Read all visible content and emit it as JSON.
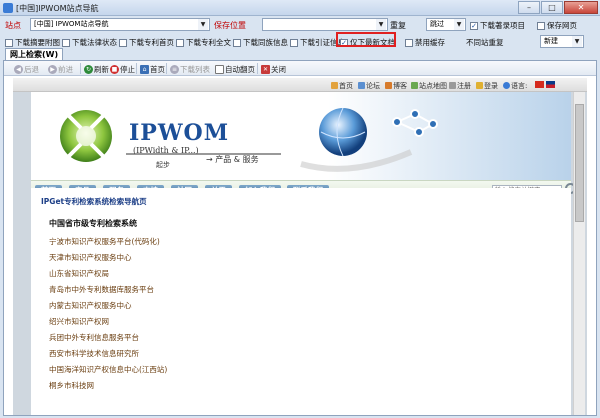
{
  "window": {
    "title": "[中国]IPWOM站点导航",
    "min": "–",
    "max": "□",
    "close": "✕"
  },
  "row1": {
    "site_label": "站点",
    "site_value": "[中国] IPWOM站点导航",
    "save_label": "保存位置",
    "save_value": "",
    "repeat_label": "重复",
    "skip_value": "跳过",
    "download_record_label": "下载著录项目",
    "save_page_label": "保存网页"
  },
  "row2": {
    "items": [
      {
        "label": "下载摘要附图",
        "checked": false
      },
      {
        "label": "下载法律状态",
        "checked": false
      },
      {
        "label": "下载专利首页",
        "checked": false
      },
      {
        "label": "下载专利全文",
        "checked": false
      },
      {
        "label": "下载同族信息",
        "checked": false
      },
      {
        "label": "下载引证信息",
        "checked": false
      },
      {
        "label": "仅下最新文档",
        "checked": true
      },
      {
        "label": "禁用缓存",
        "checked": false
      }
    ],
    "no_overwrite_label": "不同站重复",
    "new_value": "新建"
  },
  "tabs": {
    "active": "网上检索(W)"
  },
  "browser": {
    "back": "后退",
    "forward": "前进",
    "refresh": "刷新",
    "stop": "停止",
    "home": "首页",
    "list": "下载列表",
    "auto_page": "自动翻页",
    "close": "关闭"
  },
  "site": {
    "topnav": [
      "首页",
      "论坛",
      "博客",
      "站点地图",
      "注册",
      "登录",
      "语言:"
    ],
    "logo": "IPWOM",
    "logo_sub": "(IPWidth & IP...)",
    "logo_start": "起步",
    "logo_product": "→ 产品 & 服务",
    "nav": [
      "首页",
      "产品",
      "服务",
      "支持",
      "社区",
      "关于",
      "加入我们",
      "联系我们"
    ],
    "search_placeholder": "输入搜索关键字",
    "breadcrumb": "IPGet专利检索系统检索导航页",
    "section_title": "中国省市级专利检索系统",
    "links": [
      "宁波市知识产权服务平台(代码化)",
      "天津市知识产权服务中心",
      "山东省知识产权局",
      "青岛市中外专利数据库服务平台",
      "内蒙古知识产权服务中心",
      "绍兴市知识产权网",
      "兵团中外专利信息服务平台",
      "西安市科学技术信息研究所",
      "中国海洋知识产权信息中心(江西站)",
      "桐乡市科技网"
    ]
  },
  "colors": {
    "accent_red": "#e02020",
    "link_brown": "#6a3e10",
    "logo_blue": "#1c4f98"
  }
}
